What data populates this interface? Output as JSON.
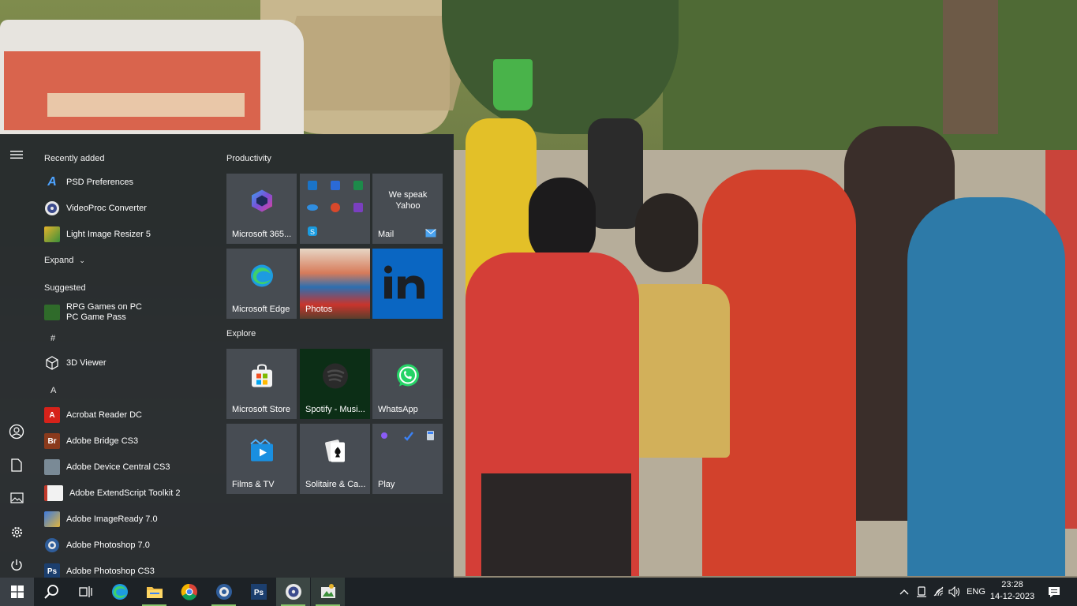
{
  "start_menu": {
    "recently_added": {
      "title": "Recently added",
      "items": [
        {
          "label": "PSD Preferences",
          "icon": "psd-preferences-icon"
        },
        {
          "label": "VideoProc Converter",
          "icon": "videoproc-icon"
        },
        {
          "label": "Light Image Resizer 5",
          "icon": "light-image-resizer-icon"
        }
      ]
    },
    "expand_label": "Expand",
    "suggested": {
      "title": "Suggested",
      "item_line1": "RPG Games on PC",
      "item_line2": "PC Game Pass"
    },
    "letter_hash": "#",
    "app_3d_viewer": "3D Viewer",
    "letter_a": "A",
    "a_apps": [
      {
        "label": "Acrobat Reader DC",
        "badge": "A"
      },
      {
        "label": "Adobe Bridge CS3",
        "badge": "Br"
      },
      {
        "label": "Adobe Device Central CS3",
        "badge": ""
      },
      {
        "label": "Adobe ExtendScript Toolkit 2",
        "badge": ""
      },
      {
        "label": "Adobe ImageReady 7.0",
        "badge": ""
      },
      {
        "label": "Adobe Photoshop 7.0",
        "badge": ""
      },
      {
        "label": "Adobe Photoshop CS3",
        "badge": "Ps"
      }
    ],
    "groups": {
      "productivity": "Productivity",
      "explore": "Explore"
    },
    "tiles": {
      "m365": "Microsoft 365...",
      "mail": "Mail",
      "mail_tagline": "We speak Yahoo",
      "edge": "Microsoft Edge",
      "photos": "Photos",
      "store": "Microsoft Store",
      "spotify": "Spotify - Musi...",
      "whatsapp": "WhatsApp",
      "films": "Films & TV",
      "solitaire": "Solitaire & Ca...",
      "play": "Play"
    }
  },
  "taskbar": {
    "language": "ENG",
    "time": "23:28",
    "date": "14-12-2023"
  },
  "colors": {
    "accent_green": "#88c56b",
    "linkedin_blue": "#0a66c2",
    "spotify_green": "#1db954",
    "whatsapp_green": "#25d366"
  }
}
